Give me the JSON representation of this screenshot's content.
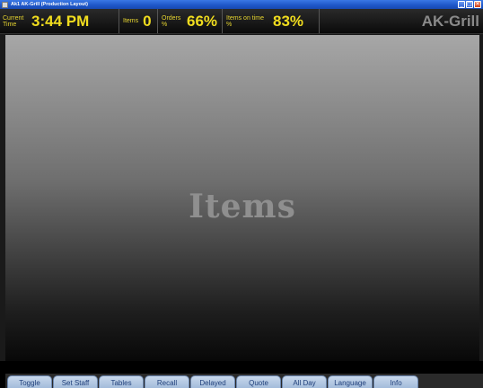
{
  "window": {
    "title": "Ak1 AK-Grill (Production Layout)",
    "buttons": {
      "minimize": "_",
      "maximize": "□",
      "close": "✕"
    }
  },
  "stats": {
    "current_time_label": "Current Time",
    "current_time": "3:44 PM",
    "items_label": "Items",
    "items_value": "0",
    "orders_label": "Orders %",
    "orders_value": "66%",
    "items_on_time_label": "Items on time %",
    "items_on_time_value": "83%"
  },
  "brand": "AK-Grill",
  "items_area": {
    "watermark": "Items"
  },
  "tabs": [
    "Toggle",
    "Set Staff",
    "Tables",
    "Recall",
    "Delayed",
    "Quote",
    "All Day",
    "Language",
    "Info"
  ],
  "colors": {
    "accent": "#f0dc1e",
    "tab_text": "#1f3f7a",
    "titlebar": "#1e56c8"
  }
}
